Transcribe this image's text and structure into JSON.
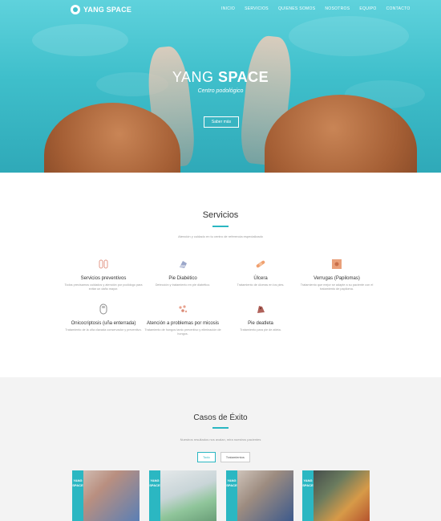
{
  "nav": {
    "logo_text": "YANG SPACE",
    "items": [
      "INICIO",
      "SERVICIOS",
      "QUIENES SOMOS",
      "NOSOTROS",
      "EQUIPO",
      "CONTACTO"
    ]
  },
  "hero": {
    "title_light": "YANG ",
    "title_bold": "SPACE",
    "subtitle": "Centro podológico",
    "button": "Saber más"
  },
  "services": {
    "title": "Servicios",
    "description": "Atención y cuidado en tu centro de referencia especializado",
    "items": [
      {
        "name": "Servicios preventivos",
        "text": "Todos precisamos cuidados y atención por podólogo para evitar un daño mayor.",
        "icon": "feet-icon"
      },
      {
        "name": "Pie Diabético",
        "text": "Detección y tratamiento en pie diabético.",
        "icon": "diabetic-foot-icon"
      },
      {
        "name": "Úlcera",
        "text": "Tratamiento de úlceras en los pies.",
        "icon": "bandage-icon"
      },
      {
        "name": "Verrugas (Papilomas)",
        "text": "Tratamiento que mejor se adapte a su paciente con el tratamiento de papiloma.",
        "icon": "wart-icon"
      },
      {
        "name": "Onicocriptosis (uña enterrada)",
        "text": "Tratamiento de la uña clavada conservador y preventivo.",
        "icon": "nail-icon"
      },
      {
        "name": "Atención a problemas por micosis",
        "text": "Tratamiento de hongos tanto preventivo y eliminación de hongos.",
        "icon": "fungus-icon"
      },
      {
        "name": "Pie deatleta",
        "text": "Tratamiento para pie de atleta.",
        "icon": "athlete-foot-icon"
      }
    ]
  },
  "casos": {
    "title": "Casos de Éxito",
    "description": "Nuestros resultados nos avalan, mira nuestros pacientes",
    "filters": [
      "Todo",
      "Tratamientos"
    ],
    "card_brand": "YANG SPACE"
  },
  "colors": {
    "accent": "#2bb7c2",
    "hero_water": "#3fbfcb",
    "skin": "#a55f35"
  }
}
